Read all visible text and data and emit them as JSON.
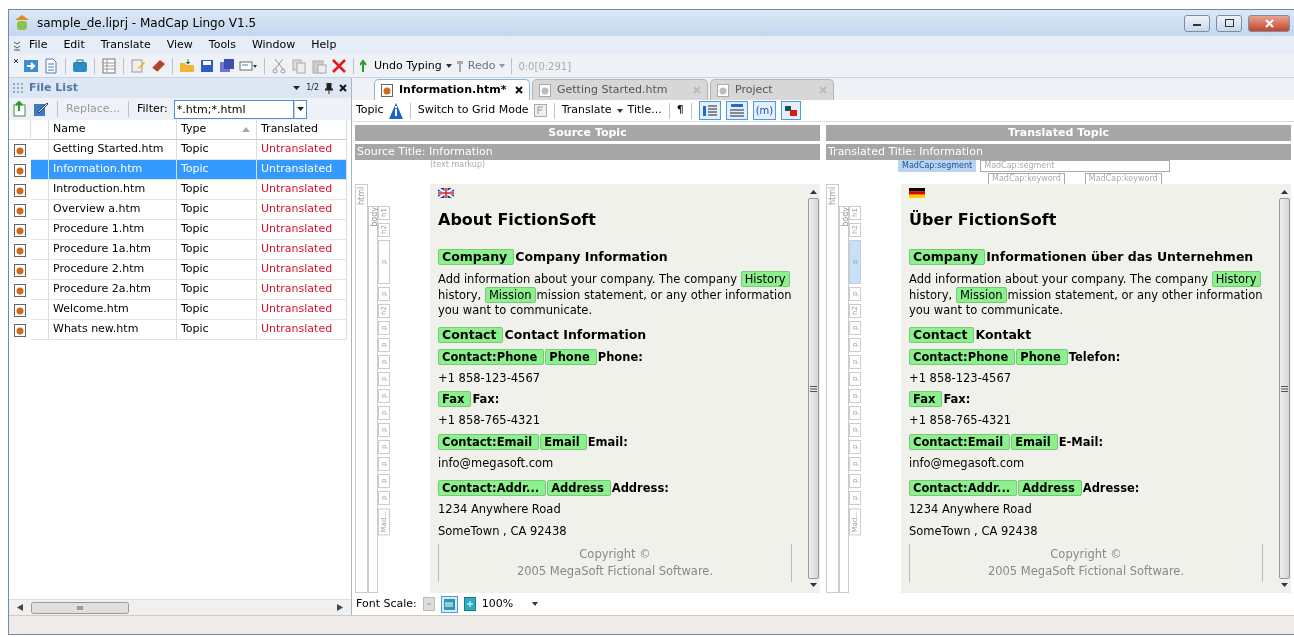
{
  "window": {
    "title": "sample_de.liprj - MadCap Lingo V1.5"
  },
  "menu": [
    "File",
    "Edit",
    "Translate",
    "View",
    "Tools",
    "Window",
    "Help"
  ],
  "toolbar": {
    "undo": "Undo Typing",
    "redo": "Redo",
    "position": "0:0[0:291]"
  },
  "file_list": {
    "title": "File List",
    "pager": "1/2",
    "replace": "Replace...",
    "filter_label": "Filter:",
    "filter_value": "*.htm;*.html",
    "columns": [
      "Name",
      "Type",
      "Translated"
    ],
    "rows": [
      {
        "name": "Getting Started.htm",
        "type": "Topic",
        "status": "Untranslated",
        "selected": false
      },
      {
        "name": "Information.htm",
        "type": "Topic",
        "status": "Untranslated",
        "selected": true
      },
      {
        "name": "Introduction.htm",
        "type": "Topic",
        "status": "Untranslated",
        "selected": false
      },
      {
        "name": "Overview a.htm",
        "type": "Topic",
        "status": "Untranslated",
        "selected": false
      },
      {
        "name": "Procedure 1.htm",
        "type": "Topic",
        "status": "Untranslated",
        "selected": false
      },
      {
        "name": "Procedure 1a.htm",
        "type": "Topic",
        "status": "Untranslated",
        "selected": false
      },
      {
        "name": "Procedure 2.htm",
        "type": "Topic",
        "status": "Untranslated",
        "selected": false
      },
      {
        "name": "Procedure 2a.htm",
        "type": "Topic",
        "status": "Untranslated",
        "selected": false
      },
      {
        "name": "Welcome.htm",
        "type": "Topic",
        "status": "Untranslated",
        "selected": false
      },
      {
        "name": "Whats new.htm",
        "type": "Topic",
        "status": "Untranslated",
        "selected": false
      }
    ]
  },
  "tabs": [
    {
      "label": "Information.htm*",
      "selected": true
    },
    {
      "label": "Getting Started.htm",
      "selected": false
    },
    {
      "label": "Project",
      "selected": false
    }
  ],
  "topic_toolbar": {
    "topic": "Topic",
    "grid": "Switch to Grid Mode",
    "translate": "Translate",
    "title": "Title...",
    "pilcrow": "¶",
    "markup": "(m)"
  },
  "panes": [
    {
      "kind": "source",
      "header": "Source Topic",
      "title": "Source Title: Information",
      "markup": [
        {
          "label": "(text markup)",
          "selected": false
        }
      ],
      "rail": {
        "root": "html",
        "body": "body",
        "tags": [
          {
            "label": "h1",
            "selected": false
          },
          {
            "label": "h2",
            "selected": false
          },
          {
            "label": "p",
            "selected": false
          },
          {
            "label": "p",
            "selected": false
          },
          {
            "label": "h2",
            "selected": false
          },
          {
            "label": "p",
            "selected": false
          },
          {
            "label": "p",
            "selected": false
          },
          {
            "label": "p",
            "selected": false
          },
          {
            "label": "p",
            "selected": false
          },
          {
            "label": "p",
            "selected": false
          },
          {
            "label": "p",
            "selected": false
          },
          {
            "label": "p",
            "selected": false
          },
          {
            "label": "p",
            "selected": false
          },
          {
            "label": "p",
            "selected": false
          },
          {
            "label": "p",
            "selected": false
          },
          {
            "label": "p",
            "selected": false
          },
          {
            "label": "Mad...",
            "selected": false
          }
        ]
      },
      "blocks": [
        {
          "kind": "h1",
          "text": "About FictionSoft"
        },
        {
          "kind": "h2",
          "tags": [
            "Company"
          ],
          "text": "Company Information"
        },
        {
          "kind": "p",
          "runs": [
            {
              "kind": "text",
              "text": "Add information about your company. The company "
            },
            {
              "kind": "tag",
              "text": "History"
            },
            {
              "kind": "text",
              "text": "history, "
            },
            {
              "kind": "tag",
              "text": "Mission"
            },
            {
              "kind": "text",
              "text": "mission statement, or any other information you want to communicate."
            }
          ]
        },
        {
          "kind": "spacer"
        },
        {
          "kind": "h2",
          "tags": [
            "Contact"
          ],
          "text": "Contact Information"
        },
        {
          "kind": "field",
          "tags": [
            "Contact:Phone",
            "Phone"
          ],
          "text": "Phone:"
        },
        {
          "kind": "line",
          "text": "+1 858-123-4567"
        },
        {
          "kind": "field",
          "tags": [
            "Fax"
          ],
          "text": "Fax:"
        },
        {
          "kind": "line",
          "text": "+1 858-765-4321"
        },
        {
          "kind": "field",
          "tags": [
            "Contact:Email",
            "Email"
          ],
          "text": "Email:"
        },
        {
          "kind": "line",
          "text": "info@megasoft.com"
        },
        {
          "kind": "spacer"
        },
        {
          "kind": "field",
          "tags": [
            "Contact:Addr...",
            "Address"
          ],
          "text": "Address:"
        },
        {
          "kind": "line",
          "text": "1234 Anywhere Road"
        },
        {
          "kind": "line",
          "text": "SomeTown , CA 92438"
        },
        {
          "kind": "footer",
          "lines": [
            "Copyright ©",
            "2005 MegaSoft Fictional Software."
          ]
        }
      ]
    },
    {
      "kind": "translated",
      "header": "Translated Topic",
      "title": "Translated Title: Information",
      "markup": [
        {
          "label": "MadCap:segment",
          "selected": true
        },
        {
          "label": "MadCap:segment",
          "selected": false
        }
      ],
      "keywords": [
        "MadCap:keyword",
        "MadCap:keyword"
      ],
      "rail": {
        "root": "html",
        "body": "body",
        "tags": [
          {
            "label": "h1",
            "selected": false
          },
          {
            "label": "h2",
            "selected": false
          },
          {
            "label": "p",
            "selected": true
          },
          {
            "label": "p",
            "selected": false
          },
          {
            "label": "h2",
            "selected": false
          },
          {
            "label": "p",
            "selected": false
          },
          {
            "label": "p",
            "selected": false
          },
          {
            "label": "p",
            "selected": false
          },
          {
            "label": "p",
            "selected": false
          },
          {
            "label": "p",
            "selected": false
          },
          {
            "label": "p",
            "selected": false
          },
          {
            "label": "p",
            "selected": false
          },
          {
            "label": "p",
            "selected": false
          },
          {
            "label": "p",
            "selected": false
          },
          {
            "label": "p",
            "selected": false
          },
          {
            "label": "p",
            "selected": false
          },
          {
            "label": "Mad...",
            "selected": false
          }
        ]
      },
      "blocks": [
        {
          "kind": "h1",
          "text": "Über FictionSoft"
        },
        {
          "kind": "h2",
          "tags": [
            "Company"
          ],
          "text": "Informationen über das Unternehmen"
        },
        {
          "kind": "p",
          "runs": [
            {
              "kind": "text",
              "text": "Add information about your company. The company "
            },
            {
              "kind": "tag",
              "text": "History"
            },
            {
              "kind": "text",
              "text": "history, "
            },
            {
              "kind": "tag",
              "text": "Mission"
            },
            {
              "kind": "text",
              "text": "mission statement, or any other information you want to communicate."
            }
          ]
        },
        {
          "kind": "spacer"
        },
        {
          "kind": "h2",
          "tags": [
            "Contact"
          ],
          "text": "Kontakt"
        },
        {
          "kind": "field",
          "tags": [
            "Contact:Phone",
            "Phone"
          ],
          "text": "Telefon:"
        },
        {
          "kind": "line",
          "text": "+1 858-123-4567"
        },
        {
          "kind": "field",
          "tags": [
            "Fax"
          ],
          "text": "Fax:"
        },
        {
          "kind": "line",
          "text": "+1 858-765-4321"
        },
        {
          "kind": "field",
          "tags": [
            "Contact:Email",
            "Email"
          ],
          "text": "E-Mail:"
        },
        {
          "kind": "line",
          "text": "info@megasoft.com"
        },
        {
          "kind": "spacer"
        },
        {
          "kind": "field",
          "tags": [
            "Contact:Addr...",
            "Address"
          ],
          "text": "Adresse:"
        },
        {
          "kind": "line",
          "text": "1234 Anywhere Road"
        },
        {
          "kind": "line",
          "text": "SomeTown , CA 92438"
        },
        {
          "kind": "footer",
          "lines": [
            "Copyright ©",
            "2005 MegaSoft Fictional Software."
          ]
        }
      ]
    }
  ],
  "font_scale": {
    "label": "Font Scale:",
    "value": "100%"
  }
}
